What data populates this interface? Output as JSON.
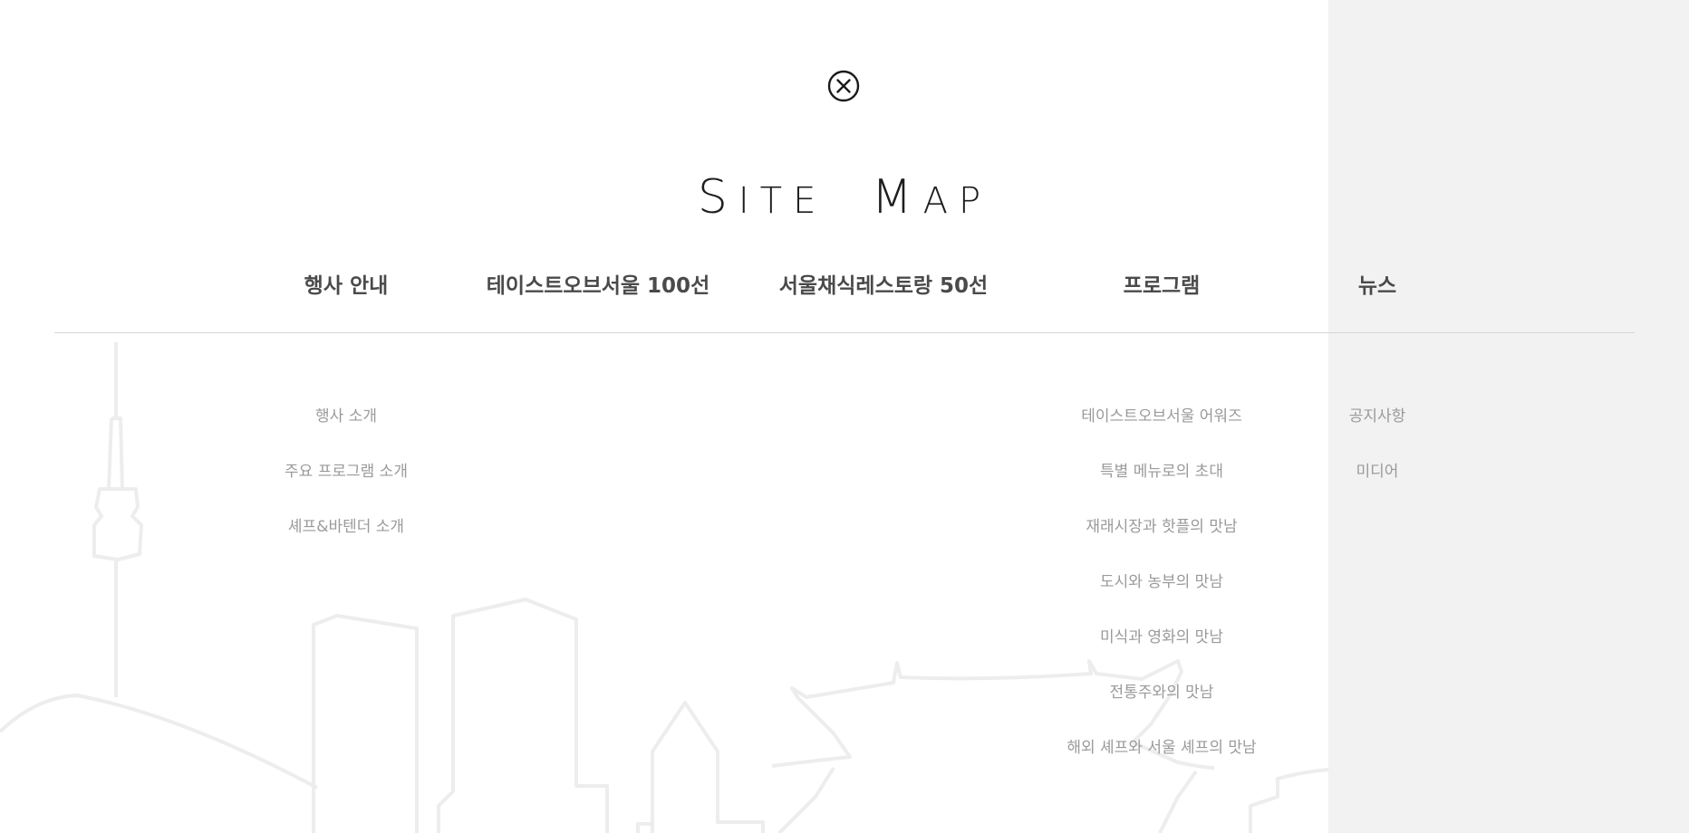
{
  "title": {
    "first_letter_a": "S",
    "rest_a": "ITE",
    "first_letter_b": "M",
    "rest_b": "AP"
  },
  "close_icon": "close-circle-icon",
  "colors": {
    "heading": "#4a4a4a",
    "item": "#9a9a9a",
    "panel": "#f2f2f2",
    "skyline": "#ededed"
  },
  "nav": {
    "columns": [
      {
        "label": "행사 안내",
        "items": [
          "행사 소개",
          "주요 프로그램 소개",
          "셰프&바텐더 소개"
        ]
      },
      {
        "label": "테이스트오브서울 100선",
        "items": []
      },
      {
        "label": "서울채식레스토랑 50선",
        "items": []
      },
      {
        "label": "프로그램",
        "items": [
          "테이스트오브서울 어워즈",
          "특별 메뉴로의 초대",
          "재래시장과 핫플의 맛남",
          "도시와 농부의 맛남",
          "미식과 영화의 맛남",
          "전통주와의 맛남",
          "해외 셰프와 서울 셰프의 맛남"
        ]
      },
      {
        "label": "뉴스",
        "items": [
          "공지사항",
          "미디어"
        ]
      }
    ]
  }
}
